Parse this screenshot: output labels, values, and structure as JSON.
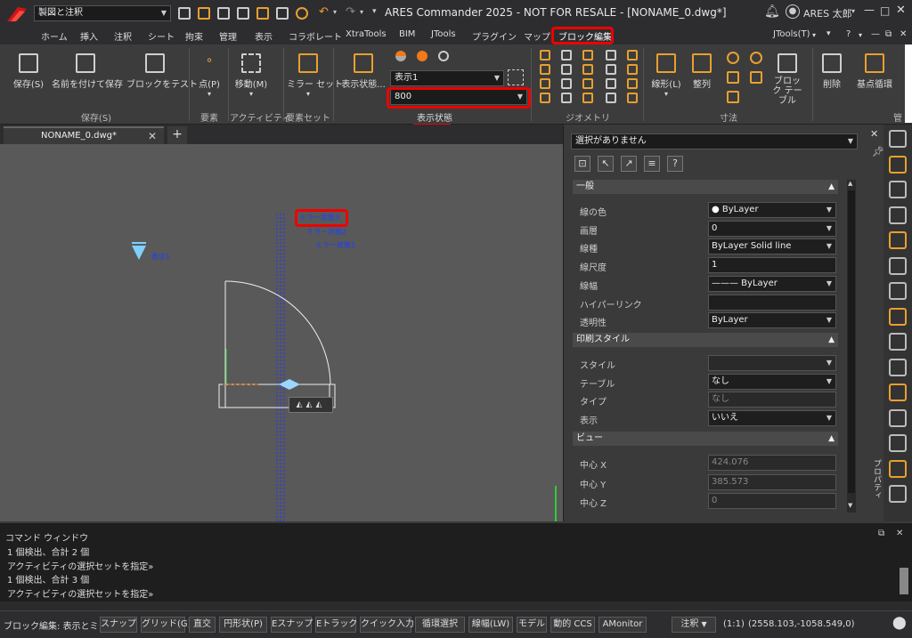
{
  "title_bar": {
    "workspace": "製図と注釈",
    "title": "ARES Commander 2025 - NOT FOR RESALE - [NONAME_0.dwg*]",
    "user": "ARES 太郎"
  },
  "menu": [
    "ホーム",
    "挿入",
    "注釈",
    "シート",
    "拘束",
    "管理",
    "表示",
    "コラボレート",
    "XtraTools",
    "BIM",
    "JTools",
    "プラグイン",
    "マップ",
    "ブロック編集"
  ],
  "menu_right": "JTools(T)",
  "ribbon": {
    "save_label": "保存(S)",
    "save_as_label": "名前を付けて保存",
    "test_block_label": "ブロックをテスト",
    "save_group": "保存(S)",
    "point_label": "点(P)",
    "element_group": "要素",
    "move_label": "移動(M)",
    "activity_group": "アクティビティ",
    "mirror_set_label": "ミラー セット",
    "element_set_group": "要素セット",
    "visibility_state_label": "表示状態...",
    "visibility_dropdown": "表示1",
    "value_dropdown": "800",
    "visibility_group": "表示状態",
    "geometry_group": "ジオメトリ",
    "linear_label": "線形(L)",
    "align_label": "整列",
    "block_table_label": "ブロック\nテーブル",
    "dimension_group": "寸法",
    "delete_label": "削除",
    "base_label": "基点循環",
    "manage_group": "管"
  },
  "document_tab": "NONAME_0.dwg*",
  "canvas": {
    "mirror3": "ミラー状態3",
    "mirror2": "ミラー状態2",
    "mirror1": "ミラー状態1",
    "visibility_marker": "表示1"
  },
  "properties": {
    "selection": "選択がありません",
    "general_section": "一般",
    "rows_general": [
      {
        "label": "線の色",
        "value": "ByLayer",
        "dropdown": true,
        "dot": true
      },
      {
        "label": "画層",
        "value": "0",
        "dropdown": true
      },
      {
        "label": "線種",
        "value": "ByLayer     Solid line",
        "dropdown": true
      },
      {
        "label": "線尺度",
        "value": "1",
        "dropdown": false
      },
      {
        "label": "線幅",
        "value": "——— ByLayer",
        "dropdown": true
      },
      {
        "label": "ハイパーリンク",
        "value": "",
        "dropdown": false
      },
      {
        "label": "透明性",
        "value": "ByLayer",
        "dropdown": true
      }
    ],
    "print_section": "印刷スタイル",
    "rows_print": [
      {
        "label": "スタイル",
        "value": "",
        "dropdown": true,
        "disabled": true
      },
      {
        "label": "テーブル",
        "value": "なし",
        "dropdown": true
      },
      {
        "label": "タイプ",
        "value": "なし",
        "dropdown": false,
        "disabled": true
      },
      {
        "label": "表示",
        "value": "いいえ",
        "dropdown": true
      }
    ],
    "view_section": "ビュー",
    "rows_view": [
      {
        "label": "中心 X",
        "value": "424.076",
        "disabled": true
      },
      {
        "label": "中心 Y",
        "value": "385.573",
        "disabled": true
      },
      {
        "label": "中心 Z",
        "value": "0",
        "disabled": true
      }
    ],
    "side_tab": "プロパティ"
  },
  "command_window": {
    "title": "コマンド ウィンドウ",
    "lines": [
      "1 個検出、合計 2 個",
      "アクティビティの選択セットを指定»",
      "1 個検出、合計 3 個",
      "アクティビティの選択セットを指定»"
    ]
  },
  "status_bar": {
    "mode": "ブロック編集: 表示とミラー",
    "buttons": [
      "スナップ",
      "グリッド(G)",
      "直交",
      "円形状(P)",
      "Eスナップ",
      "Eトラック",
      "クイック入力",
      "循環選択",
      "線幅(LW)",
      "モデル",
      "動的 CCS",
      "AMonitor"
    ],
    "annotation": "注釈",
    "scale": "(1:1)",
    "coords": "(2558.103,-1058.549,0)"
  },
  "colors": {
    "accent_red": "#e00000",
    "blue_text": "#1a3fff",
    "orange": "#f07a1a"
  }
}
